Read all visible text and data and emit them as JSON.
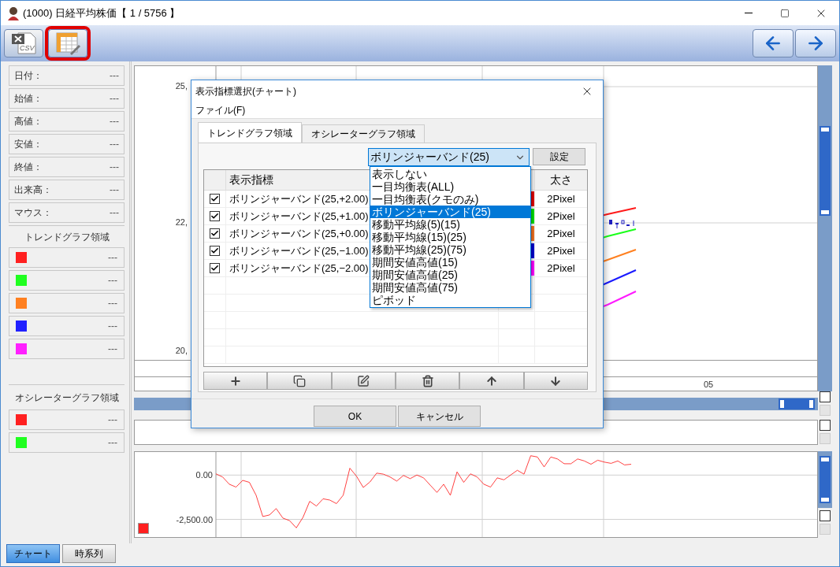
{
  "window": {
    "title": "(1000) 日経平均株価【 1 / 5756 】"
  },
  "toolbar": {
    "csv_label": "CSV",
    "buttons": [
      {
        "kind": "csv",
        "highlighted": false
      },
      {
        "kind": "table",
        "highlighted": true
      }
    ]
  },
  "sidebar": {
    "info_fields": [
      {
        "label": "日付：",
        "value": "---"
      },
      {
        "label": "始値：",
        "value": "---"
      },
      {
        "label": "高値：",
        "value": "---"
      },
      {
        "label": "安値：",
        "value": "---"
      },
      {
        "label": "終値：",
        "value": "---"
      },
      {
        "label": "出来高：",
        "value": "---"
      },
      {
        "label": "マウス：",
        "value": "---"
      }
    ],
    "trend_section": {
      "title": "トレンドグラフ領域",
      "items": [
        {
          "color": "#ff2020",
          "value": "---"
        },
        {
          "color": "#20ff20",
          "value": "---"
        },
        {
          "color": "#ff8020",
          "value": "---"
        },
        {
          "color": "#2020ff",
          "value": "---"
        },
        {
          "color": "#ff20ff",
          "value": "---"
        }
      ]
    },
    "oscillator_section": {
      "title": "オシレーターグラフ領域",
      "items": [
        {
          "color": "#ff2020",
          "value": "---"
        },
        {
          "color": "#20ff20",
          "value": "---"
        }
      ]
    }
  },
  "price_chart": {
    "y_labels": [
      "25,",
      "22,",
      "20,"
    ],
    "x_label": "05"
  },
  "oscillator_chart": {
    "chart_data": {
      "type": "line",
      "grid": true,
      "ylim": [
        -3500,
        1300
      ],
      "yticks": [
        {
          "value": 0,
          "label": "0.00"
        },
        {
          "value": -2500,
          "label": "-2,500.00"
        }
      ],
      "series": [
        {
          "color": "#ff2020",
          "values": [
            70,
            -110,
            -520,
            -680,
            -300,
            -410,
            -1140,
            -2340,
            -2250,
            -1890,
            -2430,
            -2570,
            -2980,
            -2390,
            -1480,
            -1750,
            -1340,
            -1410,
            -1610,
            -1140,
            390,
            -70,
            -700,
            -390,
            110,
            50,
            -110,
            -340,
            -20,
            -200,
            0,
            -160,
            -570,
            -980,
            -520,
            -1140,
            180,
            -410,
            70,
            -110,
            -520,
            -680,
            -160,
            -270,
            0,
            270,
            50,
            1090,
            1020,
            460,
            1020,
            910,
            640,
            640,
            910,
            800,
            610,
            840,
            730,
            660,
            800,
            570,
            610
          ]
        }
      ]
    }
  },
  "dialog": {
    "title": "表示指標選択(チャート)",
    "menu": [
      "ファイル(F)"
    ],
    "tabs": [
      {
        "label": "トレンドグラフ領域",
        "selected": true
      },
      {
        "label": "オシレーターグラフ領域",
        "selected": false
      }
    ],
    "combo": {
      "value": "ボリンジャーバンド(25)",
      "expanded": true
    },
    "set_button": "設定",
    "columns": {
      "name": "表示指標",
      "size": "太さ"
    },
    "rows": [
      {
        "checked": true,
        "name": "ボリンジャーバンド(25,+2.00)",
        "color": "#e00000",
        "size": "2Pixel"
      },
      {
        "checked": true,
        "name": "ボリンジャーバンド(25,+1.00)",
        "color": "#00e000",
        "size": "2Pixel"
      },
      {
        "checked": true,
        "name": "ボリンジャーバンド(25,+0.00)",
        "color": "#f07020",
        "size": "2Pixel"
      },
      {
        "checked": true,
        "name": "ボリンジャーバンド(25,−1.00)",
        "color": "#0000d0",
        "size": "2Pixel"
      },
      {
        "checked": true,
        "name": "ボリンジャーバンド(25,−2.00)",
        "color": "#ff00ff",
        "size": "2Pixel"
      }
    ],
    "tool_buttons": [
      {
        "kind": "add"
      },
      {
        "kind": "copy"
      },
      {
        "kind": "edit"
      },
      {
        "kind": "delete"
      },
      {
        "kind": "up"
      },
      {
        "kind": "down"
      }
    ],
    "buttons": [
      "OK",
      "キャンセル"
    ],
    "options": [
      {
        "label": "表示しない",
        "selected": false
      },
      {
        "label": "一目均衡表(ALL)",
        "selected": false
      },
      {
        "label": "一目均衡表(クモのみ)",
        "selected": false
      },
      {
        "label": "ボリンジャーバンド(25)",
        "selected": true
      },
      {
        "label": "移動平均線(5)(15)",
        "selected": false
      },
      {
        "label": "移動平均線(15)(25)",
        "selected": false
      },
      {
        "label": "移動平均線(25)(75)",
        "selected": false
      },
      {
        "label": "期間安値高値(15)",
        "selected": false
      },
      {
        "label": "期間安値高値(25)",
        "selected": false
      },
      {
        "label": "期間安値高値(75)",
        "selected": false
      },
      {
        "label": "ピボッド",
        "selected": false
      }
    ]
  },
  "bottom_tabs": [
    {
      "label": "チャート",
      "selected": true
    },
    {
      "label": "時系列",
      "selected": false
    }
  ]
}
